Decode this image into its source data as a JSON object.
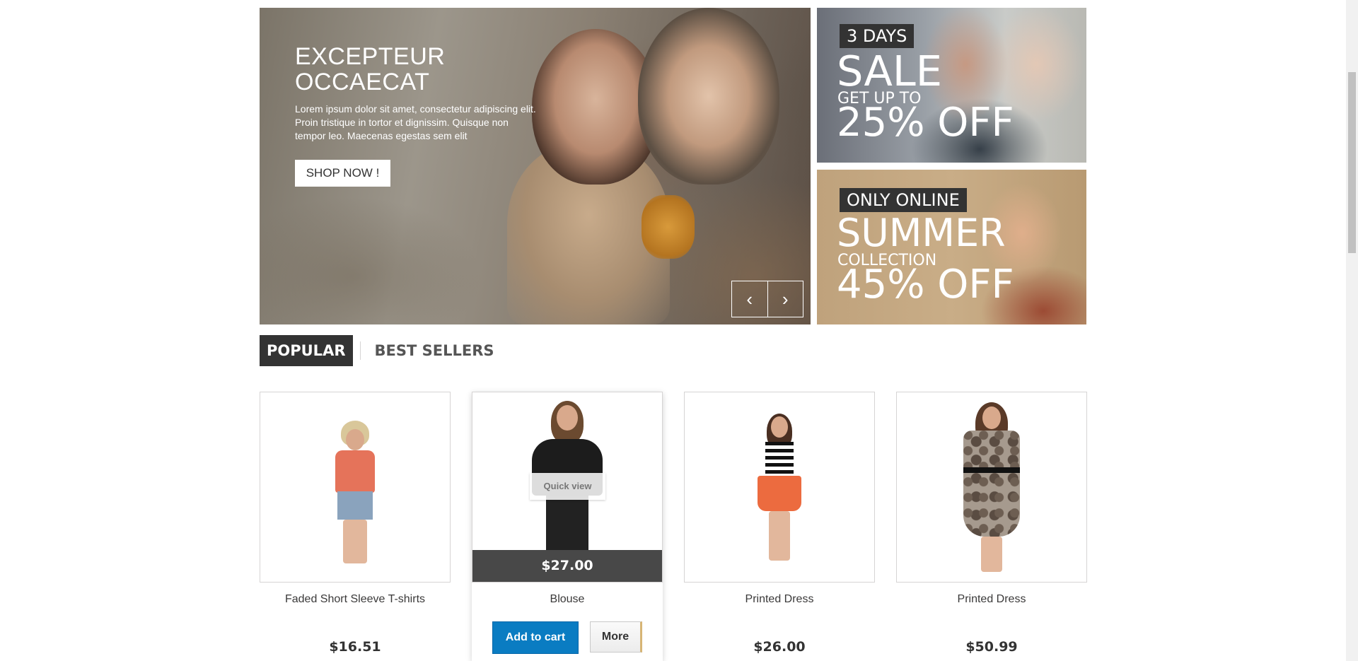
{
  "hero": {
    "title": "EXCEPTEUR\nOCCAECAT",
    "text": "Lorem ipsum dolor sit amet, consectetur adipiscing elit. Proin tristique in tortor et dignissim. Quisque non tempor leo. Maecenas egestas sem elit",
    "button": "SHOP NOW !",
    "prev_glyph": "‹",
    "next_glyph": "›"
  },
  "banners": [
    {
      "tag": "3 DAYS",
      "big": "SALE",
      "small": "GET UP TO",
      "pct": "25% OFF"
    },
    {
      "tag": "ONLY ONLINE",
      "big": "SUMMER",
      "small": "COLLECTION",
      "pct": "45% OFF"
    }
  ],
  "tabs": {
    "popular": "POPULAR",
    "best_sellers": "BEST SELLERS"
  },
  "products": [
    {
      "name": "Faded Short Sleeve T-shirts",
      "price": "$16.51"
    },
    {
      "name": "Blouse",
      "price": "$27.00",
      "quick_view": "Quick view",
      "add_to_cart": "Add to cart",
      "more": "More"
    },
    {
      "name": "Printed Dress",
      "price": "$26.00"
    },
    {
      "name": "Printed Dress",
      "price": "$50.99"
    }
  ],
  "colors": {
    "accent_blue": "#0a7cc2",
    "dark": "#333333"
  }
}
